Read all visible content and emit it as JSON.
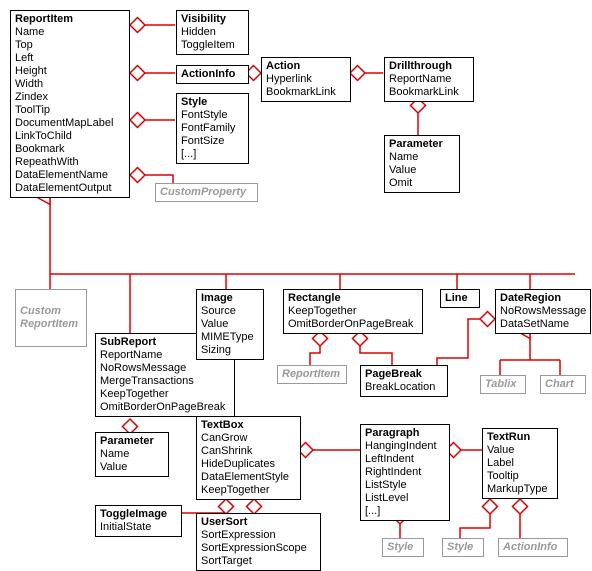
{
  "ReportItem": {
    "title": "ReportItem",
    "fields": [
      "Name",
      "Top",
      "Left",
      "Height",
      "Width",
      "Zindex",
      "ToolTip",
      "DocumentMapLabel",
      "LinkToChild",
      "Bookmark",
      "RepeathWith",
      "DataElementName",
      "DataElementOutput"
    ]
  },
  "Visibility": {
    "title": "Visibility",
    "fields": [
      "Hidden",
      "ToggleItem"
    ]
  },
  "ActionInfo": {
    "title": "ActionInfo"
  },
  "Style": {
    "title": "Style",
    "fields": [
      "FontStyle",
      "FontFamily",
      "FontSize",
      "[...]"
    ]
  },
  "CustomProperty": {
    "title": "CustomProperty"
  },
  "Action": {
    "title": "Action",
    "fields": [
      "Hyperlink",
      "BookmarkLink"
    ]
  },
  "Drillthrough": {
    "title": "Drillthrough",
    "fields": [
      "ReportName",
      "BookmarkLink"
    ]
  },
  "ParameterTop": {
    "title": "Parameter",
    "fields": [
      "Name",
      "Value",
      "Omit"
    ]
  },
  "CustomReportItem": {
    "title": "Custom\nReportItem"
  },
  "SubReport": {
    "title": "SubReport",
    "fields": [
      "ReportName",
      "NoRowsMessage",
      "MergeTransactions",
      "KeepTogether",
      "OmitBorderOnPageBreak"
    ]
  },
  "ParameterSub": {
    "title": "Parameter",
    "fields": [
      "Name",
      "Value"
    ]
  },
  "ToggleImage": {
    "title": "ToggleImage",
    "fields": [
      "InitialState"
    ]
  },
  "Image": {
    "title": "Image",
    "fields": [
      "Source",
      "Value",
      "MIMEType",
      "Sizing"
    ]
  },
  "TextBox": {
    "title": "TextBox",
    "fields": [
      "CanGrow",
      "CanShrink",
      "HideDuplicates",
      "DataElementStyle",
      "KeepTogether"
    ]
  },
  "UserSort": {
    "title": "UserSort",
    "fields": [
      "SortExpression",
      "SortExpressionScope",
      "SortTarget"
    ]
  },
  "Rectangle": {
    "title": "Rectangle",
    "fields": [
      "KeepTogether",
      "OmitBorderOnPageBreak"
    ]
  },
  "ReportItemRef": {
    "title": "ReportItem"
  },
  "PageBreak": {
    "title": "PageBreak",
    "fields": [
      "BreakLocation"
    ]
  },
  "Line": {
    "title": "Line"
  },
  "DateRegion": {
    "title": "DateRegion",
    "fields": [
      "NoRowsMessage",
      "DataSetName"
    ]
  },
  "Tablix": {
    "title": "Tablix"
  },
  "Chart": {
    "title": "Chart"
  },
  "Paragraph": {
    "title": "Paragraph",
    "fields": [
      "HangingIndent",
      "LeftIndent",
      "RightIndent",
      "ListStyle",
      "ListLevel",
      "[...]"
    ]
  },
  "TextRun": {
    "title": "TextRun",
    "fields": [
      "Value",
      "Label",
      "Tooltip",
      "MarkupType"
    ]
  },
  "StyleRef1": {
    "title": "Style"
  },
  "StyleRef2": {
    "title": "Style"
  },
  "ActionInfoRef": {
    "title": "ActionInfo"
  }
}
